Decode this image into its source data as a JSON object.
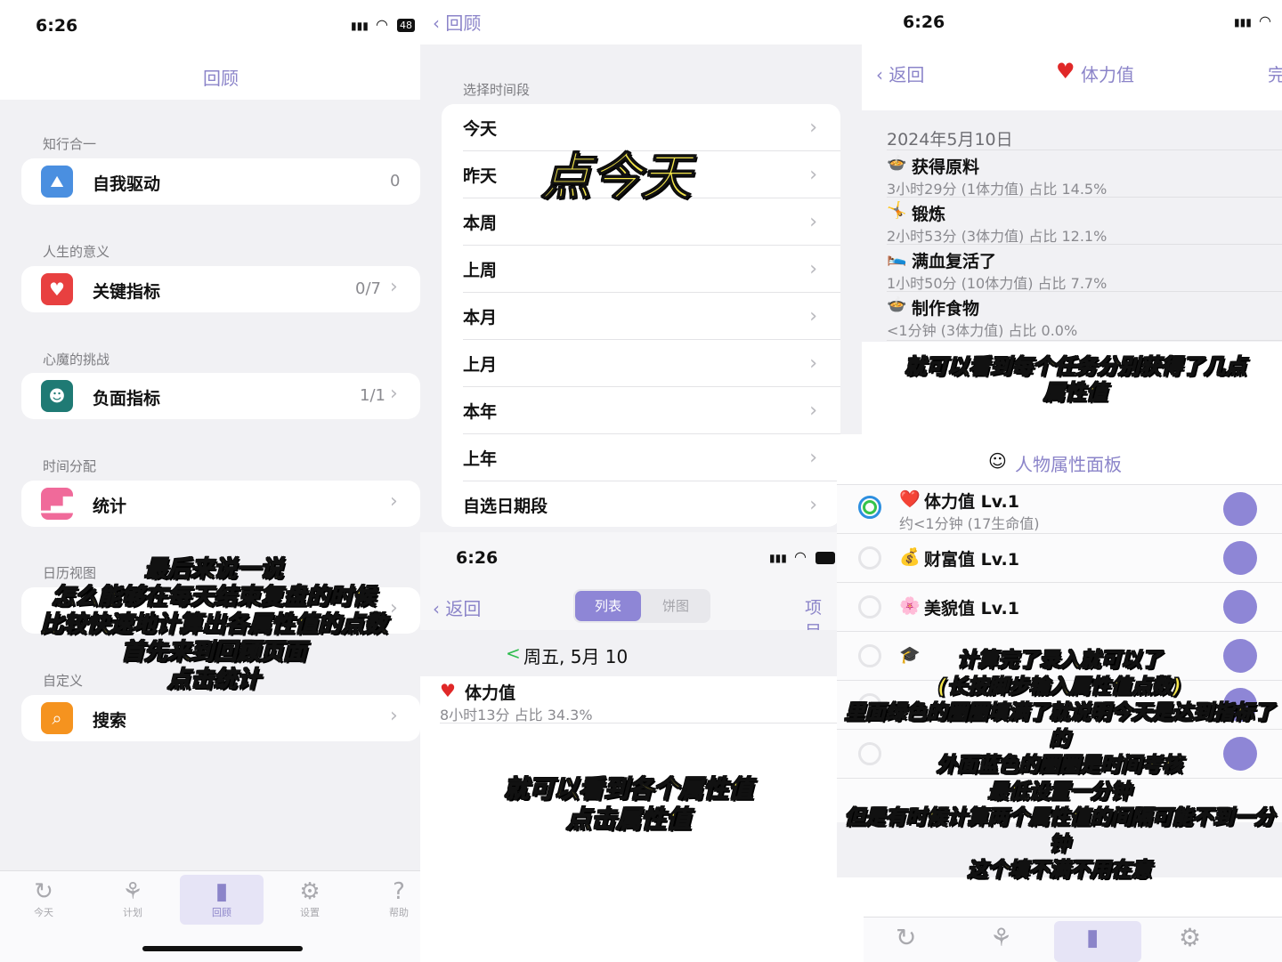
{
  "panel1": {
    "status_time": "6:26",
    "battery": "48",
    "title": "回顾",
    "sections": [
      {
        "title": "知行合一",
        "item": "自我驱动",
        "value": "0"
      },
      {
        "title": "人生的意义",
        "item": "关键指标",
        "value": "0/7"
      },
      {
        "title": "心魔的挑战",
        "item": "负面指标",
        "value": "1/1"
      },
      {
        "title": "时间分配",
        "item": "统计",
        "value": ""
      },
      {
        "title": "日历视图",
        "item": "",
        "value": ""
      },
      {
        "title": "自定义",
        "item": "搜索",
        "value": ""
      }
    ],
    "tabs": [
      "今天",
      "计划",
      "回顾",
      "设置",
      "帮助"
    ],
    "caption": [
      "最后来说一说",
      "怎么能够在每天结束复盘的时候",
      "比较快速地计算出各属性值的点数",
      "首先来到回顾页面",
      "点击统计"
    ]
  },
  "panel2": {
    "back": "回顾",
    "section_title": "选择时间段",
    "periods": [
      "今天",
      "昨天",
      "本周",
      "上周",
      "本月",
      "上月",
      "本年",
      "上年",
      "自选日期段"
    ],
    "caption": "点今天"
  },
  "panel3": {
    "status_time": "6:26",
    "back": "返回",
    "seg_list": "列表",
    "seg_pie": "饼图",
    "right_label": "项目",
    "date_label": "周五, 5月 10",
    "attr_name": "体力值",
    "attr_detail": "8小时13分 占比 34.3%",
    "caption": [
      "就可以看到各个属性值",
      "点击属性值"
    ]
  },
  "panel4": {
    "status_time": "6:26",
    "back": "返回",
    "title": "体力值",
    "right_label": "完",
    "date": "2024年5月10日",
    "entries": [
      {
        "icon": "🍲",
        "name": "获得原料",
        "detail": "3小时29分 (1体力值) 占比 14.5%"
      },
      {
        "icon": "🤸",
        "name": "锻炼",
        "detail": "2小时53分 (3体力值) 占比 12.1%"
      },
      {
        "icon": "🛌",
        "name": "满血复活了",
        "detail": "1小时50分 (10体力值) 占比 7.7%"
      },
      {
        "icon": "🍲",
        "name": "制作食物",
        "detail": "<1分钟 (3体力值) 占比 0.0%"
      }
    ],
    "caption": [
      "就可以看到每个任务分别获得了几点",
      "属性值"
    ]
  },
  "panel5": {
    "header": "人物属性面板",
    "attributes": [
      {
        "icon": "❤️",
        "name": "体力值 Lv.1",
        "detail": "约<1分钟 (17生命值)"
      },
      {
        "icon": "💰",
        "name": "财富值 Lv.1",
        "detail": ""
      },
      {
        "icon": "🌸",
        "name": "美貌值 Lv.1",
        "detail": ""
      },
      {
        "icon": "🎓",
        "name": "",
        "detail": ""
      },
      {
        "icon": "",
        "name": "",
        "detail": ""
      },
      {
        "icon": "",
        "name": "",
        "detail": ""
      }
    ],
    "caption": [
      "计算完了录入就可以了",
      "(长按脚步输入属性值点数)",
      "里面绿色的圈圈填满了就说明今天是达到指标了的",
      "外面蓝色的圈圈是时间考核",
      "最低设置一分钟",
      "但是有时候计算两个属性值的间隔可能不到一分钟",
      "这个填不满不用在意"
    ]
  }
}
